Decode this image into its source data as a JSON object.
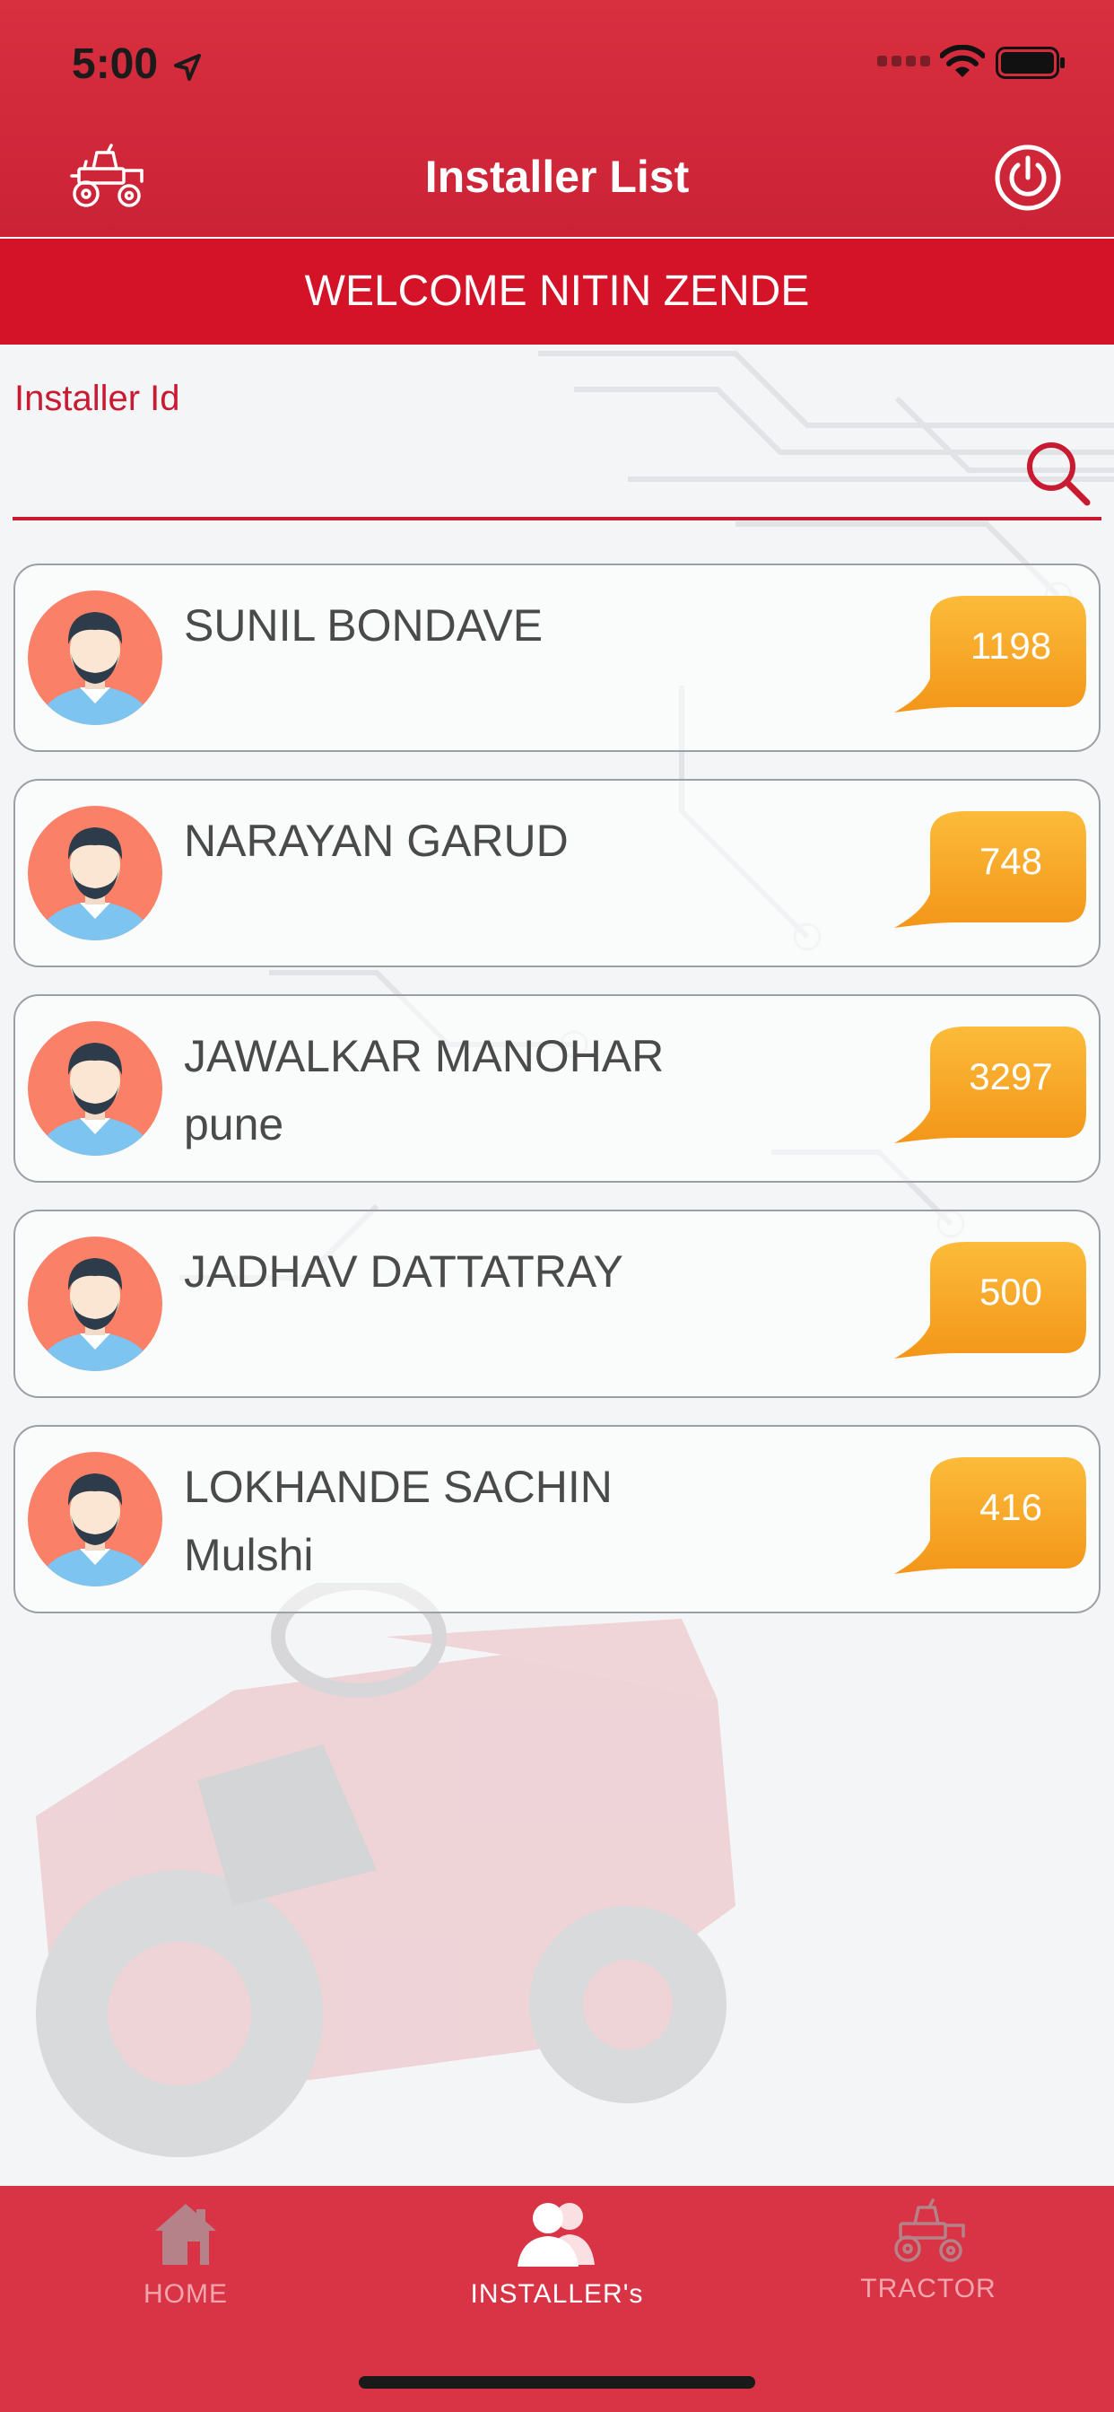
{
  "status_bar": {
    "time": "5:00"
  },
  "header": {
    "title": "Installer List",
    "welcome": "WELCOME NITIN ZENDE"
  },
  "search": {
    "label": "Installer Id",
    "value": "",
    "placeholder": ""
  },
  "installers": [
    {
      "name": "SUNIL BONDAVE",
      "city": "",
      "count": "1198"
    },
    {
      "name": "NARAYAN GARUD",
      "city": "",
      "count": "748"
    },
    {
      "name": "JAWALKAR MANOHAR",
      "city": "pune",
      "count": "3297"
    },
    {
      "name": "JADHAV DATTATRAY",
      "city": "",
      "count": "500"
    },
    {
      "name": "LOKHANDE SACHIN",
      "city": "Mulshi",
      "count": "416"
    }
  ],
  "tabs": [
    {
      "label": "HOME",
      "icon": "home-icon",
      "active": false
    },
    {
      "label": "INSTALLER's",
      "icon": "users-icon",
      "active": true
    },
    {
      "label": "TRACTOR",
      "icon": "tractor-icon",
      "active": false
    }
  ],
  "colors": {
    "primary_red": "#d41228",
    "header_red": "#d8303f",
    "badge_orange": "#f7a021",
    "text_gray": "#4a4a4a"
  }
}
